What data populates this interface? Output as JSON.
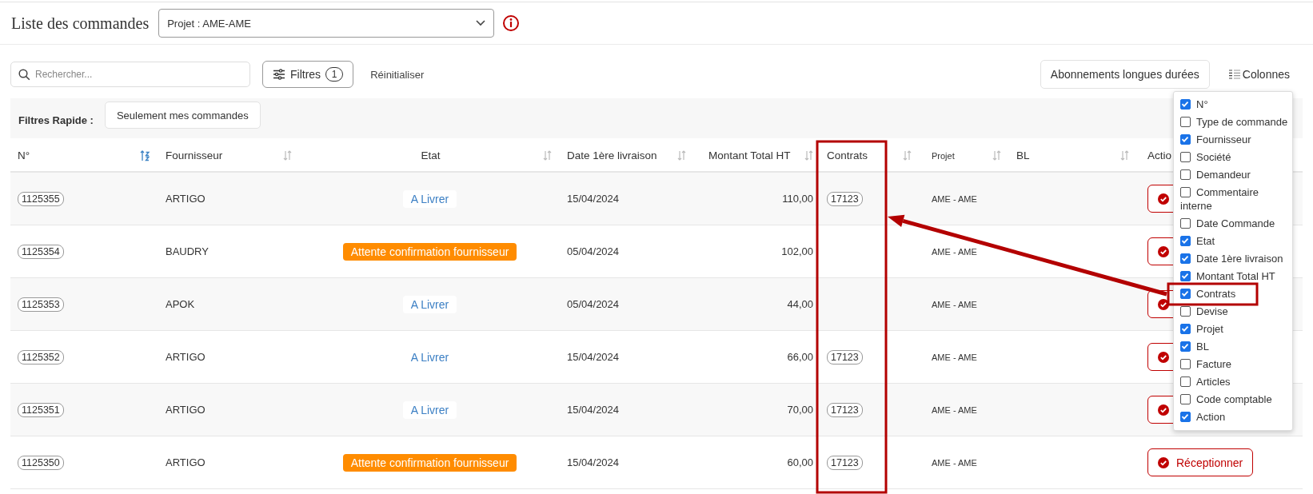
{
  "header": {
    "title": "Liste des commandes",
    "project_select": {
      "value": "Projet : AME-AME"
    }
  },
  "toolbar": {
    "search": {
      "placeholder": "Rechercher..."
    },
    "filters_button": {
      "label": "Filtres",
      "count": "1"
    },
    "reset_link": "Réinitialiser",
    "subscriptions_button": "Abonnements longues durées",
    "columns_button": "Colonnes"
  },
  "quick_filters": {
    "label": "Filtres Rapide :",
    "buttons": [
      "Seulement mes commandes"
    ]
  },
  "table": {
    "columns": [
      {
        "label": "N°",
        "sorted": true,
        "highlighted": false
      },
      {
        "label": "Fournisseur",
        "sorted": false,
        "highlighted": false
      },
      {
        "label": "Etat",
        "sorted": false,
        "highlighted": false
      },
      {
        "label": "Date 1ère livraison",
        "sorted": false,
        "highlighted": false
      },
      {
        "label": "Montant Total HT",
        "sorted": false,
        "highlighted": false
      },
      {
        "label": "Contrats",
        "sorted": false,
        "highlighted": true
      },
      {
        "label": "Projet",
        "sorted": false,
        "highlighted": false
      },
      {
        "label": "BL",
        "sorted": false,
        "highlighted": false
      },
      {
        "label": "Actio",
        "highlighted": false
      }
    ],
    "rows": [
      {
        "number": "1125355",
        "supplier": "ARTIGO",
        "status": {
          "label": "A Livrer",
          "kind": "to_deliver"
        },
        "date": "15/04/2024",
        "amount": "110,00",
        "contract": "17123",
        "project": "AME - AME"
      },
      {
        "number": "1125354",
        "supplier": "BAUDRY",
        "status": {
          "label": "Attente confirmation fournisseur",
          "kind": "awaiting"
        },
        "date": "05/04/2024",
        "amount": "102,00",
        "project": "AME - AME"
      },
      {
        "number": "1125353",
        "supplier": "APOK",
        "status": {
          "label": "A Livrer",
          "kind": "to_deliver"
        },
        "date": "05/04/2024",
        "amount": "44,00",
        "project": "AME - AME"
      },
      {
        "number": "1125352",
        "supplier": "ARTIGO",
        "status": {
          "label": "A Livrer",
          "kind": "to_deliver"
        },
        "date": "15/04/2024",
        "amount": "66,00",
        "contract": "17123",
        "project": "AME - AME"
      },
      {
        "number": "1125351",
        "supplier": "ARTIGO",
        "status": {
          "label": "A Livrer",
          "kind": "to_deliver"
        },
        "date": "15/04/2024",
        "amount": "70,00",
        "contract": "17123",
        "project": "AME - AME"
      },
      {
        "number": "1125350",
        "supplier": "ARTIGO",
        "status": {
          "label": "Attente confirmation fournisseur",
          "kind": "awaiting"
        },
        "date": "15/04/2024",
        "amount": "60,00",
        "contract": "17123",
        "project": "AME - AME",
        "action": "Réceptionner"
      }
    ]
  },
  "columns_menu": {
    "items": [
      {
        "label": "N°",
        "checked": true,
        "highlighted": false
      },
      {
        "label": "Type de commande",
        "checked": false,
        "highlighted": false
      },
      {
        "label": "Fournisseur",
        "checked": true,
        "highlighted": false
      },
      {
        "label": "Société",
        "checked": false,
        "highlighted": false
      },
      {
        "label": "Demandeur",
        "checked": false,
        "highlighted": false
      },
      {
        "label": "Commentaire interne",
        "checked": false,
        "highlighted": false
      },
      {
        "label": "Date Commande",
        "checked": false,
        "highlighted": false
      },
      {
        "label": "Etat",
        "checked": true,
        "highlighted": false
      },
      {
        "label": "Date 1ère livraison",
        "checked": true,
        "highlighted": false
      },
      {
        "label": "Montant Total HT",
        "checked": true,
        "highlighted": false
      },
      {
        "label": "Contrats",
        "checked": true,
        "highlighted": true
      },
      {
        "label": "Devise",
        "checked": false,
        "highlighted": false
      },
      {
        "label": "Projet",
        "checked": true,
        "highlighted": false
      },
      {
        "label": "BL",
        "checked": true,
        "highlighted": false
      },
      {
        "label": "Facture",
        "checked": false,
        "highlighted": false
      },
      {
        "label": "Articles",
        "checked": false,
        "highlighted": false
      },
      {
        "label": "Code comptable",
        "checked": false,
        "highlighted": false
      },
      {
        "label": "Action",
        "checked": true,
        "highlighted": false
      }
    ]
  }
}
